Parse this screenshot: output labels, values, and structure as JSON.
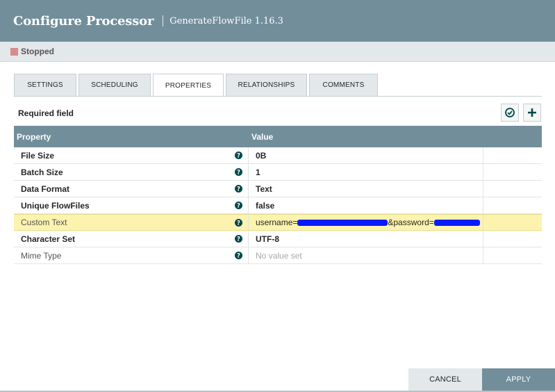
{
  "dialog": {
    "title": "Configure Processor",
    "subtitle": "GenerateFlowFile 1.16.3"
  },
  "status": {
    "label": "Stopped",
    "color": "#d98a8a"
  },
  "tabs": [
    {
      "label": "SETTINGS",
      "active": false
    },
    {
      "label": "SCHEDULING",
      "active": false
    },
    {
      "label": "PROPERTIES",
      "active": true
    },
    {
      "label": "RELATIONSHIPS",
      "active": false
    },
    {
      "label": "COMMENTS",
      "active": false
    }
  ],
  "properties": {
    "required_label": "Required field",
    "columns": {
      "property": "Property",
      "value": "Value"
    },
    "rows": [
      {
        "name": "File Size",
        "value": "0B",
        "required": true
      },
      {
        "name": "Batch Size",
        "value": "1",
        "required": true
      },
      {
        "name": "Data Format",
        "value": "Text",
        "required": true
      },
      {
        "name": "Unique FlowFiles",
        "value": "false",
        "required": true
      },
      {
        "name": "Custom Text",
        "value_prefix": "username=",
        "value_mid": "&password=",
        "required": false,
        "selected": true
      },
      {
        "name": "Character Set",
        "value": "UTF-8",
        "required": true
      },
      {
        "name": "Mime Type",
        "value": "No value set",
        "required": false,
        "empty": true
      }
    ]
  },
  "footer": {
    "cancel_label": "CANCEL",
    "apply_label": "APPLY"
  },
  "colors": {
    "header": "#728e9b",
    "highlight": "#fcf3ae",
    "redaction": "#0a1aff"
  }
}
